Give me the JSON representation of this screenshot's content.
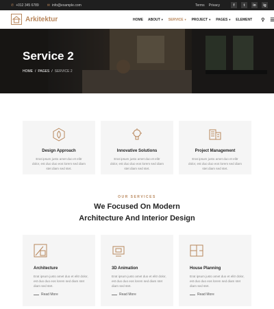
{
  "topbar": {
    "phone": "+012 345 6789",
    "email": "info@example.com",
    "links": [
      "Terms",
      "Privacy"
    ],
    "social": [
      "f",
      "t",
      "in",
      "ig"
    ]
  },
  "header": {
    "brand": "Arkitektur",
    "nav": [
      "HOME",
      "ABOUT",
      "SERVICE",
      "PROJECT",
      "PAGES",
      "ELEMENT"
    ],
    "active": "SERVICE"
  },
  "hero": {
    "title": "Service 2",
    "breadcrumb": [
      "HOME",
      "/",
      "PAGES",
      "/",
      "SERVICE 2"
    ]
  },
  "features": [
    {
      "title": "Design Approach",
      "text": "Erat ipsum justo amet duo et elitr dolor, est duo duo eos lorem sed diam stet diam sed stet."
    },
    {
      "title": "Innovative Solutions",
      "text": "Erat ipsum justo amet duo et elitr dolor, est duo duo eos lorem sed diam stet diam sed stet."
    },
    {
      "title": "Project Management",
      "text": "Erat ipsum justo amet duo et elitr dolor, est duo duo eos lorem sed diam stet diam sed stet."
    }
  ],
  "section": {
    "eyebrow": "OUR SERVICES",
    "title_line1": "We Focused On Modern",
    "title_line2": "Architecture And Interior Design"
  },
  "services": [
    {
      "title": "Architecture",
      "text": "Erat ipsum justo amet duo et elitr dolor, est duo duo eos lorem sed diam stet diam sed stet.",
      "more": "Read More"
    },
    {
      "title": "3D Animation",
      "text": "Erat ipsum justo amet duo et elitr dolor, est duo duo eos lorem sed diam stet diam sed stet.",
      "more": "Read More"
    },
    {
      "title": "House Planning",
      "text": "Erat ipsum justo amet duo et elitr dolor, est duo duo eos lorem sed diam stet diam sed stet.",
      "more": "Read More"
    }
  ],
  "colors": {
    "accent": "#b8865b",
    "dark": "#1f1f1f",
    "card": "#f5f5f5"
  }
}
